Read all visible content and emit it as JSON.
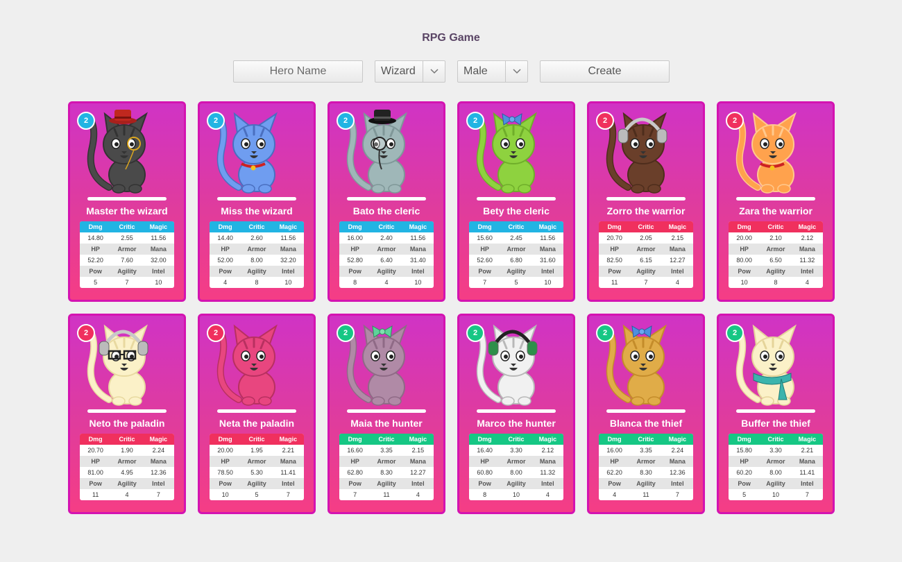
{
  "app": {
    "title": "RPG Game"
  },
  "form": {
    "name_placeholder": "Hero Name",
    "class_value": "Wizard",
    "gender_value": "Male",
    "create_label": "Create"
  },
  "stat_headers": {
    "row1": [
      "Dmg",
      "Critic",
      "Magic"
    ],
    "row2": [
      "HP",
      "Armor",
      "Mana"
    ],
    "row3": [
      "Pow",
      "Agility",
      "Intel"
    ]
  },
  "colors": {
    "blue": "#22b4e3",
    "red": "#f0305e",
    "green": "#16c784"
  },
  "heroes": [
    {
      "name": "Master the wizard",
      "level": "2",
      "team": "blue",
      "fur": "#4a4a4a",
      "stripe": "#333333",
      "acc": "tophat-red",
      "dmg": "14.80",
      "critic": "2.55",
      "magic": "11.56",
      "hp": "52.20",
      "armor": "7.60",
      "mana": "32.00",
      "pow": "5",
      "agility": "7",
      "intel": "10"
    },
    {
      "name": "Miss the wizard",
      "level": "2",
      "team": "blue",
      "fur": "#6f9df0",
      "stripe": "#4a6fc0",
      "acc": "collar",
      "dmg": "14.40",
      "critic": "2.60",
      "magic": "11.56",
      "hp": "52.00",
      "armor": "8.00",
      "mana": "32.20",
      "pow": "4",
      "agility": "8",
      "intel": "10"
    },
    {
      "name": "Bato the cleric",
      "level": "2",
      "team": "blue",
      "fur": "#9fb7b8",
      "stripe": "#7f9798",
      "acc": "tophat-black",
      "dmg": "16.00",
      "critic": "2.40",
      "magic": "11.56",
      "hp": "52.80",
      "armor": "6.40",
      "mana": "31.40",
      "pow": "8",
      "agility": "4",
      "intel": "10"
    },
    {
      "name": "Bety the cleric",
      "level": "2",
      "team": "blue",
      "fur": "#8ed23f",
      "stripe": "#6fae2a",
      "acc": "bow-blue",
      "dmg": "15.60",
      "critic": "2.45",
      "magic": "11.56",
      "hp": "52.60",
      "armor": "6.80",
      "mana": "31.60",
      "pow": "7",
      "agility": "5",
      "intel": "10"
    },
    {
      "name": "Zorro the warrior",
      "level": "2",
      "team": "red",
      "fur": "#6a3f2a",
      "stripe": "#4e2d1c",
      "acc": "headphones",
      "dmg": "20.70",
      "critic": "2.05",
      "magic": "2.15",
      "hp": "82.50",
      "armor": "6.15",
      "mana": "12.27",
      "pow": "11",
      "agility": "7",
      "intel": "4"
    },
    {
      "name": "Zara the warrior",
      "level": "2",
      "team": "red",
      "fur": "#ffa24d",
      "stripe": "#ffc98e",
      "acc": "collar",
      "dmg": "20.00",
      "critic": "2.10",
      "magic": "2.12",
      "hp": "80.00",
      "armor": "6.50",
      "mana": "11.32",
      "pow": "10",
      "agility": "8",
      "intel": "4"
    },
    {
      "name": "Neto the paladin",
      "level": "2",
      "team": "red",
      "fur": "#fbf1c8",
      "stripe": "#e8d9a0",
      "acc": "headphones-glasses",
      "dmg": "20.70",
      "critic": "1.90",
      "magic": "2.24",
      "hp": "81.00",
      "armor": "4.95",
      "mana": "12.36",
      "pow": "11",
      "agility": "4",
      "intel": "7"
    },
    {
      "name": "Neta the paladin",
      "level": "2",
      "team": "red",
      "fur": "#e8467f",
      "stripe": "#b83060",
      "acc": "none",
      "dmg": "20.00",
      "critic": "1.95",
      "magic": "2.21",
      "hp": "78.50",
      "armor": "5.30",
      "mana": "11.41",
      "pow": "10",
      "agility": "5",
      "intel": "7"
    },
    {
      "name": "Maia the hunter",
      "level": "2",
      "team": "green",
      "fur": "#b08aa6",
      "stripe": "#8f6a86",
      "acc": "bow-green",
      "dmg": "16.60",
      "critic": "3.35",
      "magic": "2.15",
      "hp": "62.80",
      "armor": "8.30",
      "mana": "12.27",
      "pow": "7",
      "agility": "11",
      "intel": "4"
    },
    {
      "name": "Marco the hunter",
      "level": "2",
      "team": "green",
      "fur": "#f1f1f1",
      "stripe": "#b8b8b8",
      "acc": "headphones-green",
      "dmg": "16.40",
      "critic": "3.30",
      "magic": "2.12",
      "hp": "60.80",
      "armor": "8.00",
      "mana": "11.32",
      "pow": "8",
      "agility": "10",
      "intel": "4"
    },
    {
      "name": "Blanca the thief",
      "level": "2",
      "team": "green",
      "fur": "#e0ac48",
      "stripe": "#c48c2a",
      "acc": "bow-blue",
      "dmg": "16.00",
      "critic": "3.35",
      "magic": "2.24",
      "hp": "62.20",
      "armor": "8.30",
      "mana": "12.36",
      "pow": "4",
      "agility": "11",
      "intel": "7"
    },
    {
      "name": "Buffer the thief",
      "level": "2",
      "team": "green",
      "fur": "#fbf1c8",
      "stripe": "#e5d49a",
      "acc": "scarf",
      "dmg": "15.80",
      "critic": "3.30",
      "magic": "2.21",
      "hp": "60.20",
      "armor": "8.00",
      "mana": "11.41",
      "pow": "5",
      "agility": "10",
      "intel": "7"
    }
  ]
}
